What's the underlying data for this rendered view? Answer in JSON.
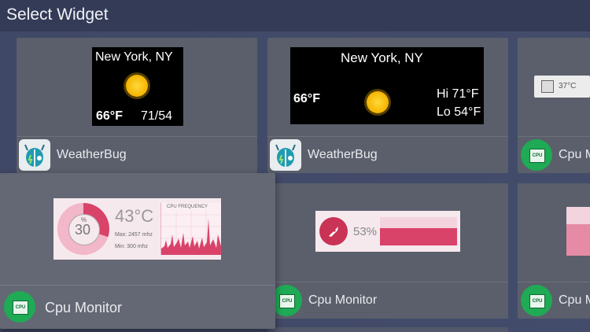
{
  "header": {
    "title": "Select Widget"
  },
  "cards": {
    "weatherbug_small": {
      "city": "New York, NY",
      "temp": "66°F",
      "hilo": "71/54",
      "app_name": "WeatherBug"
    },
    "weatherbug_wide": {
      "city": "New York, NY",
      "temp": "66°F",
      "hi": "Hi 71°F",
      "lo": "Lo 54°F",
      "app_name": "WeatherBug"
    },
    "cpu_partial_top": {
      "temp": "37°C",
      "app_name": "Cpu M"
    },
    "cpu_selected": {
      "ring_label": "%",
      "ring_value": "30",
      "temp": "43°C",
      "max": "Max: 2457 mhz",
      "min": "Min:  300 mhz",
      "graph_title": "CPU FREQUENCY",
      "app_name": "Cpu Monitor"
    },
    "cpu_middle": {
      "percent": "53%",
      "app_name": "Cpu Monitor"
    },
    "cpu_partial_bottom": {
      "app_name": "Cpu M"
    }
  },
  "colors": {
    "accent_pink": "#d9436a",
    "cpu_green": "#1faa55",
    "sun_yellow": "#f4b400"
  }
}
